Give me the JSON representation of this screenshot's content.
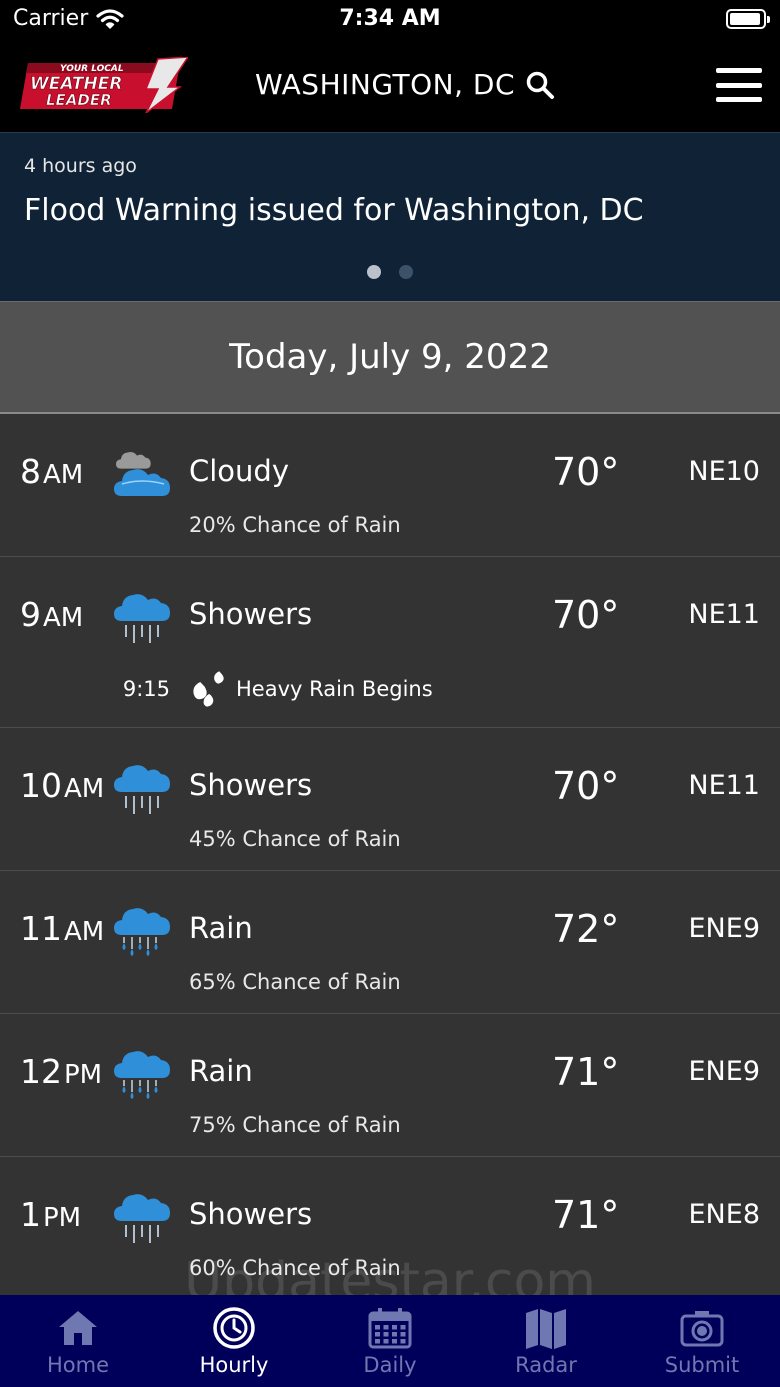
{
  "status_bar": {
    "carrier": "Carrier",
    "time": "7:34 AM",
    "battery_level": 0.95
  },
  "header": {
    "logo_text": [
      "YOUR LOCAL",
      "WEATHER",
      "LEADER"
    ],
    "location": "WASHINGTON, DC",
    "icons": [
      "search-icon",
      "hamburger-menu-icon"
    ]
  },
  "alert": {
    "time_ago": "4 hours ago",
    "title": "Flood Warning issued for Washington, DC",
    "page_count": 2,
    "active_page": 1
  },
  "date_label": "Today, July 9, 2022",
  "hours": [
    {
      "hour": "8",
      "suffix": "AM",
      "icon": "partly-cloudy-icon",
      "condition": "Cloudy",
      "sub": "20% Chance of Rain",
      "temp": "70°",
      "wind": "NE10"
    },
    {
      "hour": "9",
      "suffix": "AM",
      "icon": "showers-icon",
      "condition": "Showers",
      "sub": "",
      "temp": "70°",
      "wind": "NE11",
      "event": {
        "time": "9:15",
        "icon": "heavy-rain-drops-icon",
        "text": "Heavy Rain Begins"
      }
    },
    {
      "hour": "10",
      "suffix": "AM",
      "icon": "showers-icon",
      "condition": "Showers",
      "sub": "45% Chance of Rain",
      "temp": "70°",
      "wind": "NE11"
    },
    {
      "hour": "11",
      "suffix": "AM",
      "icon": "rain-icon",
      "condition": "Rain",
      "sub": "65% Chance of Rain",
      "temp": "72°",
      "wind": "ENE9"
    },
    {
      "hour": "12",
      "suffix": "PM",
      "icon": "rain-icon",
      "condition": "Rain",
      "sub": "75% Chance of Rain",
      "temp": "71°",
      "wind": "ENE9"
    },
    {
      "hour": "1",
      "suffix": "PM",
      "icon": "showers-icon",
      "condition": "Showers",
      "sub": "60% Chance of Rain",
      "temp": "71°",
      "wind": "ENE8"
    }
  ],
  "watermark": "Updatestar.com",
  "tabs": [
    {
      "label": "Home",
      "icon": "home-icon",
      "active": false
    },
    {
      "label": "Hourly",
      "icon": "clock-icon",
      "active": true
    },
    {
      "label": "Daily",
      "icon": "calendar-icon",
      "active": false
    },
    {
      "label": "Radar",
      "icon": "map-icon",
      "active": false
    },
    {
      "label": "Submit",
      "icon": "camera-icon",
      "active": false
    }
  ],
  "colors": {
    "header_bg": "#000000",
    "alert_bg": "#0f2236",
    "date_bg": "#525252",
    "list_bg": "#333333",
    "tab_bar_bg": "#00005a",
    "icon_blue": "#2f8fd8",
    "tab_inactive": "#6f78b0"
  }
}
